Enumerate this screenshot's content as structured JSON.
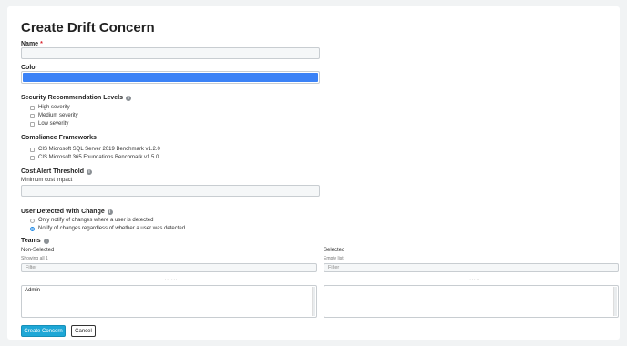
{
  "form": {
    "title": "Create Drift Concern",
    "name_label": "Name",
    "required_mark": "*",
    "name_value": "",
    "color_label": "Color",
    "color_value": "#3b82f6",
    "security": {
      "label": "Security Recommendation Levels",
      "options": [
        "High severity",
        "Medium severity",
        "Low severity"
      ]
    },
    "compliance": {
      "label": "Compliance Frameworks",
      "options": [
        "CIS Microsoft SQL Server 2019 Benchmark v1.2.0",
        "CIS Microsoft 365 Foundations Benchmark v1.5.0"
      ]
    },
    "cost": {
      "label": "Cost Alert Threshold",
      "sublabel": "Minimum cost impact",
      "value": ""
    },
    "user_change": {
      "label": "User Detected With Change",
      "options": [
        "Only notify of changes where a user is detected",
        "Notify of changes regardless of whether a user was detected"
      ],
      "selected_index": 1
    },
    "teams": {
      "label": "Teams",
      "non_selected": {
        "title": "Non-Selected",
        "info": "Showing all 1",
        "filter_placeholder": "Filter",
        "items": [
          "Admin"
        ]
      },
      "selected": {
        "title": "Selected",
        "info": "Empty list",
        "filter_placeholder": "Filter",
        "items": []
      },
      "dots": "......"
    },
    "buttons": {
      "create": "Create Concern",
      "cancel": "Cancel"
    }
  }
}
